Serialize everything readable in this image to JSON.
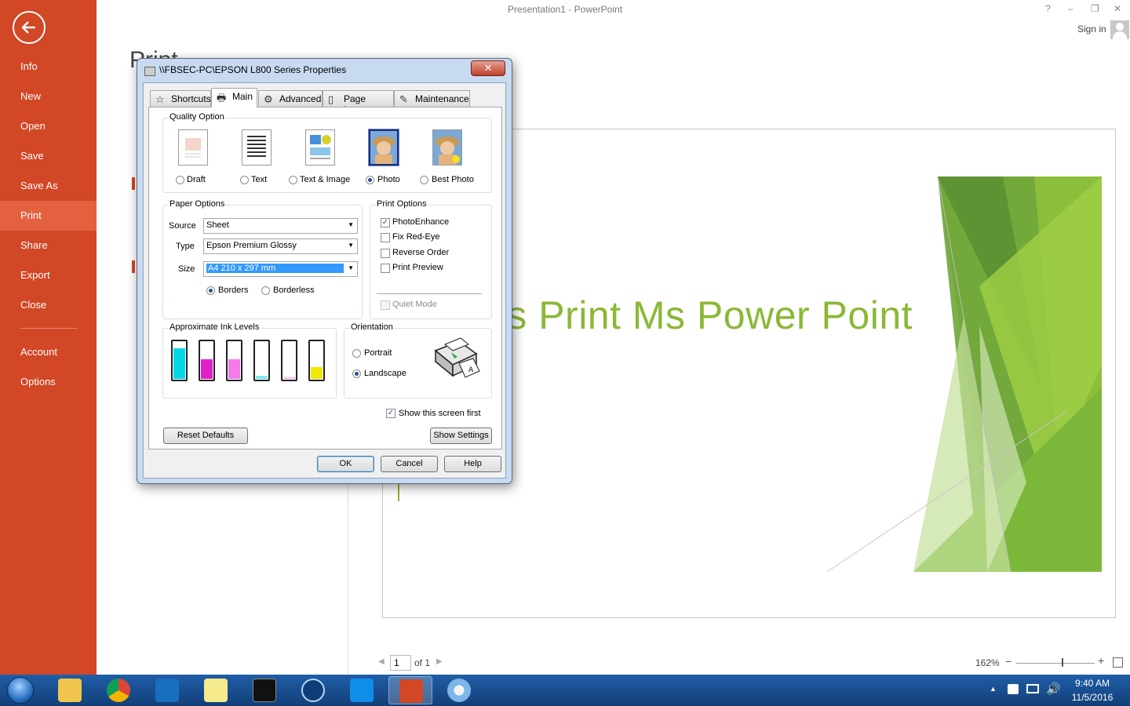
{
  "app": {
    "title": "Presentation1 - PowerPoint",
    "sign_in": "Sign in",
    "help": "?",
    "minimize": "–",
    "restore": "❐",
    "close": "✕"
  },
  "backstage": {
    "items": [
      "Info",
      "New",
      "Open",
      "Save",
      "Save As",
      "Print",
      "Share",
      "Export",
      "Close",
      "Account",
      "Options"
    ],
    "active": "Print"
  },
  "print_pane": {
    "heading": "Print"
  },
  "slide": {
    "title_visible": "ps Print Ms Power Point"
  },
  "preview_nav": {
    "page": "1",
    "of": "of 1",
    "zoom": "162%"
  },
  "dialog": {
    "title": "\\\\FBSEC-PC\\EPSON L800 Series Properties",
    "close": "✕",
    "tabs": [
      "Shortcuts",
      "Main",
      "Advanced",
      "Page Layout",
      "Maintenance"
    ],
    "active_tab": "Main",
    "quality": {
      "group_label": "Quality Option",
      "options": [
        "Draft",
        "Text",
        "Text & Image",
        "Photo",
        "Best Photo"
      ],
      "selected": "Photo"
    },
    "paper": {
      "group_label": "Paper Options",
      "source_label": "Source",
      "source_value": "Sheet",
      "type_label": "Type",
      "type_value": "Epson Premium Glossy",
      "size_label": "Size",
      "size_value": "A4 210 x 297 mm",
      "borders": "Borders",
      "borderless": "Borderless",
      "border_selected": "Borders"
    },
    "print_options": {
      "group_label": "Print Options",
      "photo_enhance": {
        "label": "PhotoEnhance",
        "checked": true
      },
      "fix_red_eye": {
        "label": "Fix Red-Eye",
        "checked": false
      },
      "reverse_order": {
        "label": "Reverse Order",
        "checked": false
      },
      "print_preview": {
        "label": "Print Preview",
        "checked": false
      },
      "quiet_mode": {
        "label": "Quiet Mode",
        "checked": false,
        "disabled": true
      }
    },
    "ink": {
      "group_label": "Approximate Ink Levels",
      "levels": [
        {
          "color": "#00d8e8",
          "level": 0.8
        },
        {
          "color": "#e020c8",
          "level": 0.5
        },
        {
          "color": "#f47be8",
          "level": 0.5
        },
        {
          "color": "#7fe8ee",
          "level": 0.08
        },
        {
          "color": "#f5b8ee",
          "level": 0.04
        },
        {
          "color": "#f0e800",
          "level": 0.3
        }
      ]
    },
    "orientation": {
      "group_label": "Orientation",
      "portrait": "Portrait",
      "landscape": "Landscape",
      "selected": "Landscape"
    },
    "show_first": {
      "label": "Show this screen first",
      "checked": true
    },
    "buttons": {
      "reset": "Reset Defaults",
      "show_settings": "Show Settings",
      "ok": "OK",
      "cancel": "Cancel",
      "help": "Help"
    }
  },
  "taskbar": {
    "time": "9:40 AM",
    "date": "11/5/2016"
  },
  "colors": {
    "accent": "#d24726",
    "slide_green": "#8bb835"
  }
}
